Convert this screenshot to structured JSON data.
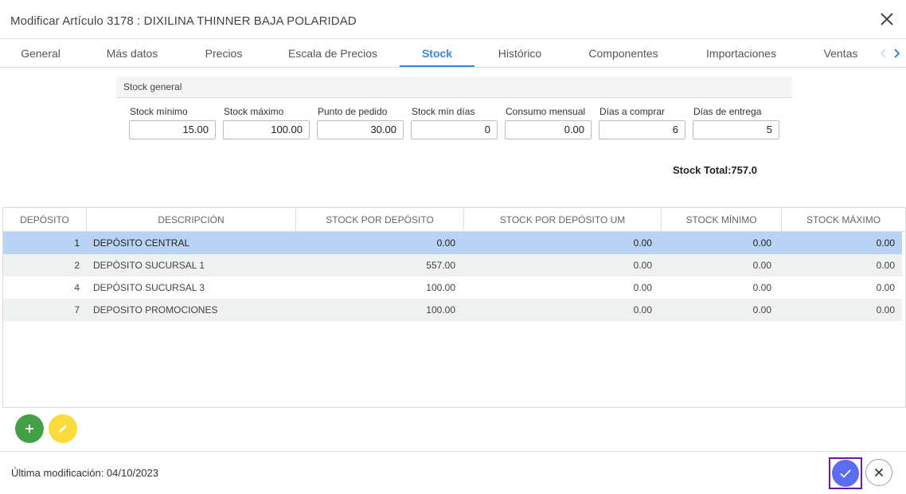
{
  "dialog": {
    "title": "Modificar Artículo 3178 : DIXILINA THINNER BAJA POLARIDAD"
  },
  "tabs": [
    {
      "label": "General"
    },
    {
      "label": "Más datos"
    },
    {
      "label": "Precios"
    },
    {
      "label": "Escala de Precios"
    },
    {
      "label": "Stock",
      "active": true
    },
    {
      "label": "Histórico"
    },
    {
      "label": "Componentes"
    },
    {
      "label": "Importaciones"
    },
    {
      "label": "Ventas"
    }
  ],
  "stock_general": {
    "section_title": "Stock general",
    "fields": [
      {
        "label": "Stock mínimo",
        "value": "15.00"
      },
      {
        "label": "Stock máximo",
        "value": "100.00"
      },
      {
        "label": "Punto de pedido",
        "value": "30.00"
      },
      {
        "label": "Stock mín días",
        "value": "0"
      },
      {
        "label": "Consumo mensual",
        "value": "0.00"
      },
      {
        "label": "Días a comprar",
        "value": "6"
      },
      {
        "label": "Días de entrega",
        "value": "5"
      }
    ],
    "stock_total": "Stock Total:757.0"
  },
  "table": {
    "columns": [
      "DEPÓSITO",
      "DESCRIPCIÓN",
      "STOCK POR DEPÓSITO",
      "STOCK POR DEPÓSITO UM",
      "STOCK MÍNIMO",
      "STOCK MÁXIMO"
    ],
    "rows": [
      {
        "deposito": "1",
        "descripcion": "DEPÓSITO CENTRAL",
        "stock": "0.00",
        "stock_um": "0.00",
        "minimo": "0.00",
        "maximo": "0.00"
      },
      {
        "deposito": "2",
        "descripcion": "DEPÓSITO SUCURSAL 1",
        "stock": "557.00",
        "stock_um": "0.00",
        "minimo": "0.00",
        "maximo": "0.00"
      },
      {
        "deposito": "4",
        "descripcion": "DEPÓSITO SUCURSAL 3",
        "stock": "100.00",
        "stock_um": "0.00",
        "minimo": "0.00",
        "maximo": "0.00"
      },
      {
        "deposito": "7",
        "descripcion": "DEPOSITO PROMOCIONES",
        "stock": "100.00",
        "stock_um": "0.00",
        "minimo": "0.00",
        "maximo": "0.00"
      }
    ],
    "selected_row": 0
  },
  "actions": {
    "add_icon": "plus-icon",
    "edit_icon": "pencil-icon",
    "confirm_icon": "check-icon",
    "cancel_icon": "close-icon"
  },
  "footer": {
    "last_modified": "Última modificación: 04/10/2023"
  },
  "colors": {
    "accent": "#3b87d6",
    "selected_row": "#b9d3f5",
    "add_button": "#43a047",
    "edit_button": "#fbdb3a",
    "confirm_button": "#5b6cf0"
  }
}
